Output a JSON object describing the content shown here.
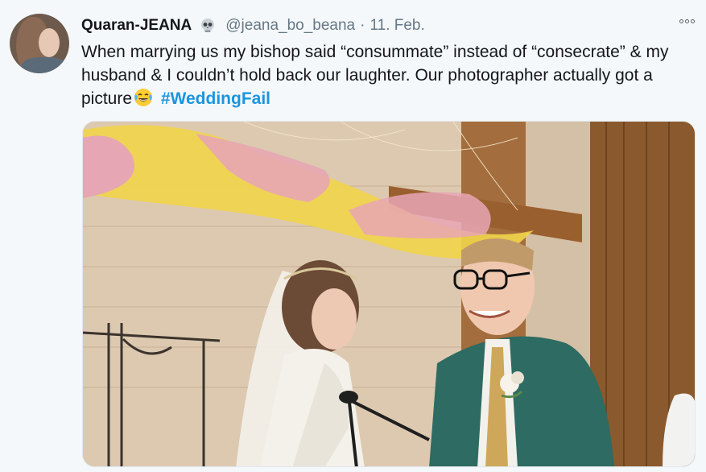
{
  "tweet": {
    "author_name": "Quaran-JEANA",
    "author_badge_icon": "skull-emoji",
    "author_handle": "@jeana_bo_beana",
    "separator": "·",
    "date": "11. Feb.",
    "text_before_emoji": "When marrying us my bishop said “consummate” instead of “consecrate” & my husband & I couldn’t hold back our laughter. Our photographer actually got a picture",
    "emoji_icon": "face-with-tears-of-joy-emoji",
    "hashtag": "#WeddingFail",
    "more_icon": "more-options-icon"
  },
  "colors": {
    "background": "#f5f8fa",
    "text": "#14171a",
    "muted": "#657786",
    "link": "#1b95e0"
  }
}
